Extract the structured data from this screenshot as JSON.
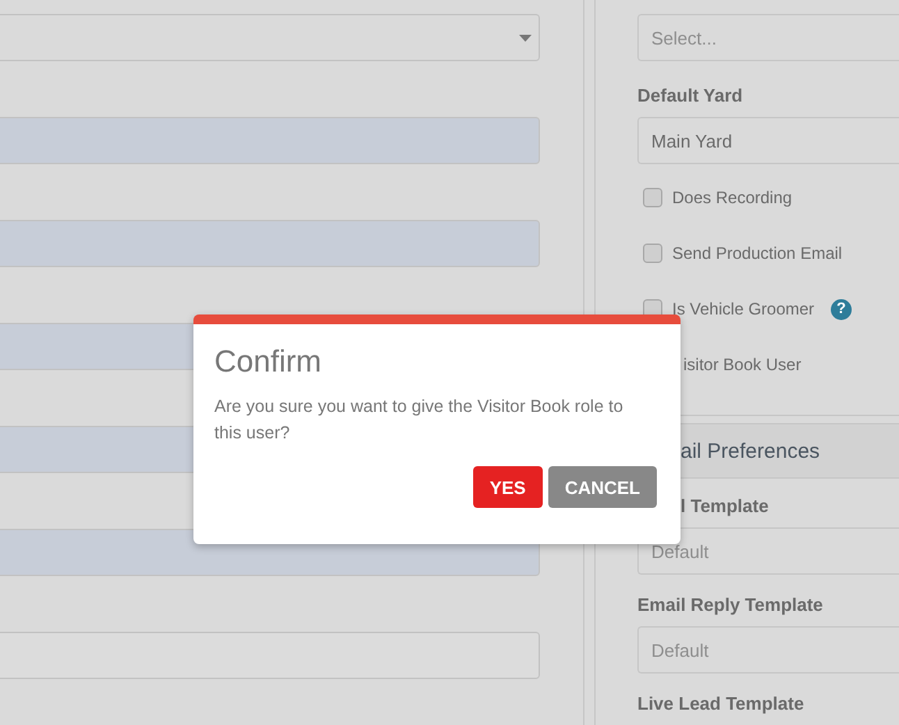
{
  "left_form": {
    "fields": [
      {
        "kind": "select"
      },
      {
        "kind": "readonly"
      },
      {
        "kind": "readonly"
      },
      {
        "kind": "readonly"
      },
      {
        "kind": "readonly"
      },
      {
        "kind": "readonly"
      },
      {
        "kind": "text"
      }
    ]
  },
  "right_panel": {
    "select": {
      "placeholder": "Select..."
    },
    "default_yard": {
      "label": "Default Yard",
      "value": "Main Yard"
    },
    "checkboxes": [
      {
        "label": "Does Recording",
        "checked": false
      },
      {
        "label": "Send Production Email",
        "checked": false
      },
      {
        "label": "Is Vehicle Groomer",
        "checked": false,
        "help": "?"
      },
      {
        "label": "isitor Book User"
      }
    ]
  },
  "email_preferences": {
    "title": "ail Preferences",
    "templates": [
      {
        "label": "l Template",
        "placeholder": "Default"
      },
      {
        "label": "Email Reply Template",
        "placeholder": "Default"
      },
      {
        "label": "Live Lead Template"
      }
    ]
  },
  "dialog": {
    "title": "Confirm",
    "message": "Are you sure you want to give the Visitor Book role to this user?",
    "buttons": [
      {
        "label": "YES",
        "kind": "primary"
      },
      {
        "label": "CANCEL",
        "kind": "secondary"
      }
    ]
  }
}
